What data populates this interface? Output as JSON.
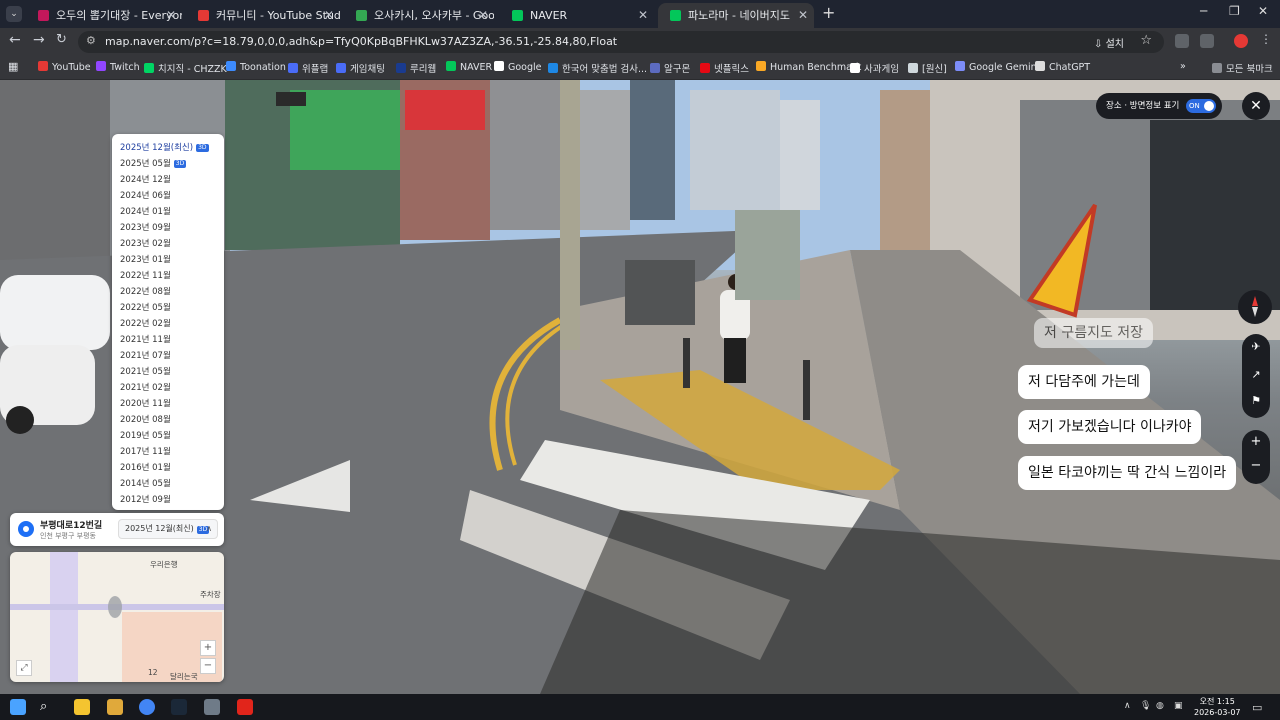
{
  "browser": {
    "tabs": [
      {
        "label": "오두의 뽑기대장 - Everyone's",
        "fav": "#c2185b",
        "active": false
      },
      {
        "label": "커뮤니티 - YouTube Studio",
        "fav": "#e53935",
        "active": false
      },
      {
        "label": "오사카시, 오사카부 - Google",
        "fav": "#34a853",
        "active": false
      },
      {
        "label": "NAVER",
        "fav": "#03c75a",
        "active": false
      },
      {
        "label": "파노라마 - 네이버지도",
        "fav": "#03c75a",
        "active": true
      }
    ],
    "url": "map.naver.com/p?c=18.79,0,0,0,adh&p=TfyQ0KpBqBFHKLw37AZ3ZA,-36.51,-25.84,80,Float",
    "install_label": "설치",
    "bookmarks": [
      {
        "label": "YouTube",
        "color": "#e53935"
      },
      {
        "label": "Twitch",
        "color": "#9146ff"
      },
      {
        "label": "치지직 - CHZZK",
        "color": "#00d564"
      },
      {
        "label": "Toonation",
        "color": "#3d8bfd"
      },
      {
        "label": "위플랩",
        "color": "#4a6cf7"
      },
      {
        "label": "게임채팅",
        "color": "#4a6cf7"
      },
      {
        "label": "루리웹",
        "color": "#1a3b8f"
      },
      {
        "label": "NAVER",
        "color": "#03c75a"
      },
      {
        "label": "Google",
        "color": "#ffffff"
      },
      {
        "label": "한국어 맞춤법 검사...",
        "color": "#1e88e5"
      },
      {
        "label": "알구몬",
        "color": "#5c6bc0"
      },
      {
        "label": "넷플릭스",
        "color": "#e50914"
      },
      {
        "label": "Human Benchmark",
        "color": "#f9a825"
      },
      {
        "label": "사과게임",
        "color": "#ffffff"
      },
      {
        "label": "[원신]",
        "color": "#cfd8dc"
      },
      {
        "label": "Google Gemini",
        "color": "#7c8cf8"
      },
      {
        "label": "ChatGPT",
        "color": "#dddddd"
      }
    ],
    "all_bookmarks_label": "모든 북마크"
  },
  "panorama": {
    "dates": [
      {
        "label": "2025년 12월(최신)",
        "badge": "3D"
      },
      {
        "label": "2025년 05월",
        "badge": "3D"
      },
      {
        "label": "2024년 12월",
        "badge": ""
      },
      {
        "label": "2024년 06월",
        "badge": ""
      },
      {
        "label": "2024년 01월",
        "badge": ""
      },
      {
        "label": "2023년 09월",
        "badge": ""
      },
      {
        "label": "2023년 02월",
        "badge": ""
      },
      {
        "label": "2023년 01월",
        "badge": ""
      },
      {
        "label": "2022년 11월",
        "badge": ""
      },
      {
        "label": "2022년 08월",
        "badge": ""
      },
      {
        "label": "2022년 05월",
        "badge": ""
      },
      {
        "label": "2022년 02월",
        "badge": ""
      },
      {
        "label": "2021년 11월",
        "badge": ""
      },
      {
        "label": "2021년 07월",
        "badge": ""
      },
      {
        "label": "2021년 05월",
        "badge": ""
      },
      {
        "label": "2021년 02월",
        "badge": ""
      },
      {
        "label": "2020년 11월",
        "badge": ""
      },
      {
        "label": "2020년 08월",
        "badge": ""
      },
      {
        "label": "2019년 05월",
        "badge": ""
      },
      {
        "label": "2017년 11월",
        "badge": ""
      },
      {
        "label": "2016년 01월",
        "badge": ""
      },
      {
        "label": "2014년 05월",
        "badge": ""
      },
      {
        "label": "2012년 09월",
        "badge": ""
      }
    ],
    "road_name": "부평대로12번길",
    "region": "인천 부평구 부평동",
    "selected_date": "2025년 12월(최신)",
    "selected_badge": "3D",
    "toggle_label": "장소 · 방면정보 표기",
    "toggle_state": "ON",
    "minimap_labels": {
      "bank": "우리은행",
      "parking": "주차장",
      "number": "12",
      "place": "달리는국"
    }
  },
  "captions": [
    {
      "text": "저 구름지도 저장",
      "faded": true
    },
    {
      "text": "저 다담주에 가는데",
      "faded": false
    },
    {
      "text": "저기 가보겠습니다 이나카야",
      "faded": false
    },
    {
      "text": "일본 타코야끼는 딱 간식 느낌이라",
      "faded": false
    }
  ],
  "taskbar": {
    "time": "오전 1:15",
    "date": "2026-03-07"
  }
}
